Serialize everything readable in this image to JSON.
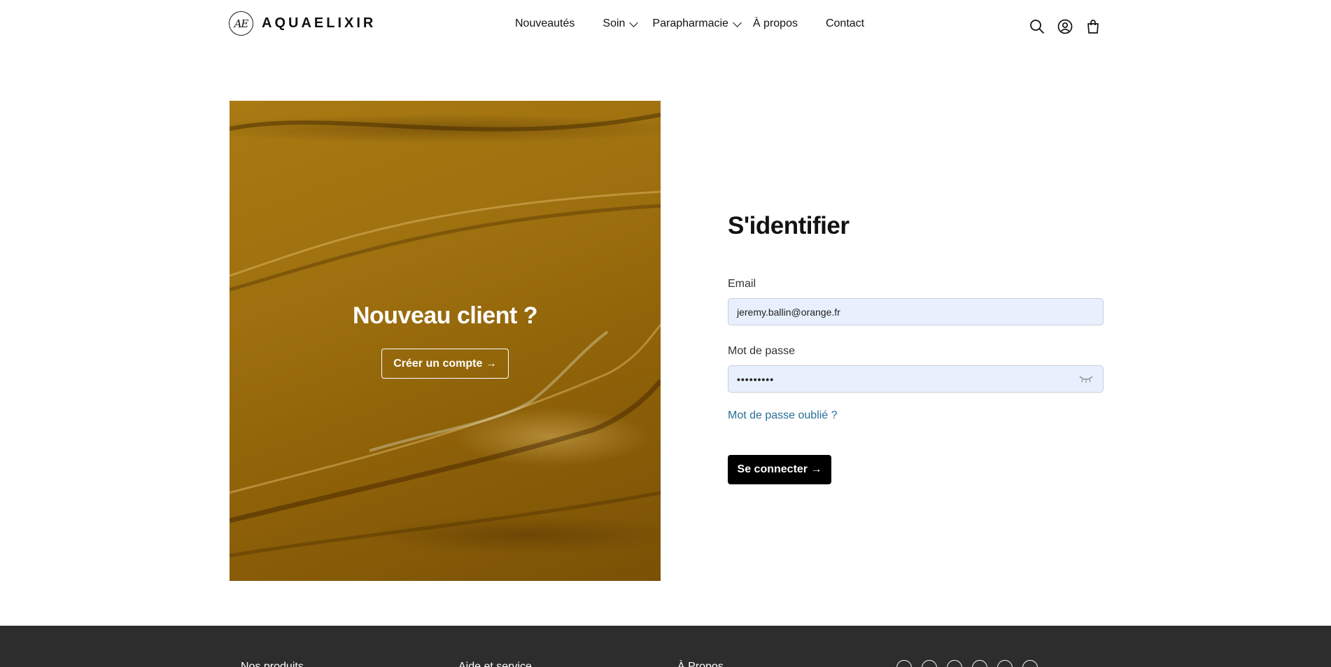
{
  "brand": {
    "mark": "AE",
    "name": "AQUAELIXIR"
  },
  "nav": {
    "items": [
      {
        "label": "Nouveautés",
        "has_dropdown": false
      },
      {
        "label": "Soin",
        "has_dropdown": true
      },
      {
        "label": "Parapharmacie",
        "has_dropdown": true
      },
      {
        "label": "À propos",
        "has_dropdown": false
      },
      {
        "label": "Contact",
        "has_dropdown": false
      }
    ]
  },
  "header_icons": [
    "search-icon",
    "account-icon",
    "cart-icon"
  ],
  "hero": {
    "title": "Nouveau client ?",
    "button_label": "Créer un compte →"
  },
  "login": {
    "title": "S'identifier",
    "email_label": "Email",
    "email_value": "jeremy.ballin@orange.fr",
    "password_label": "Mot de passe",
    "password_value": "•••••••••",
    "forgot_label": "Mot de passe oublié ?",
    "submit_label": "Se connecter →"
  },
  "footer": {
    "columns": [
      "Nos produits",
      "Aide et service",
      "À Propos"
    ],
    "social_icons": [
      "pinterest-icon",
      "facebook-icon",
      "instagram-icon",
      "tiktok-icon",
      "youtube-icon",
      "twitter-icon"
    ]
  },
  "colors": {
    "accent_link": "#2a6f97",
    "button_bg": "#000000",
    "input_bg": "#e8f0fe",
    "footer_bg": "#2d2d2d",
    "hero_bg": "#9e700f"
  }
}
